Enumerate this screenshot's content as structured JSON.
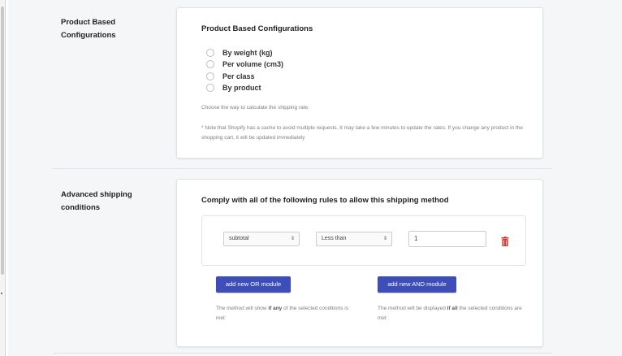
{
  "product_section": {
    "title": "Product Based Configurations",
    "card_title": "Product Based Configurations",
    "options": [
      "By weight (kg)",
      "Per volume (cm3)",
      "Per class",
      "By product"
    ],
    "help": "Choose the way to calculate the shipping rate.",
    "note": "* Note that Shopify has a cache to avoid multiple requests. It may take a few minutes to update the rates. If you change any product in the shopping cart, it will be updated immediately"
  },
  "advanced_section": {
    "title": "Advanced shipping conditions",
    "card_title": "Comply with all of the following rules to allow this shipping method",
    "rule": {
      "field": "subtotal",
      "operator": "Less than",
      "value": "1"
    },
    "or_button": "add new OR module",
    "and_button": "add new AND module",
    "or_note": {
      "before": "The method will show ",
      "bold": "if any",
      "after": " of the selected conditions is met"
    },
    "and_note": {
      "before": "The method will be displayed ",
      "bold": "if all",
      "after": " the selected conditions are met"
    }
  },
  "colors": {
    "primary_button": "#3d4eb8",
    "delete_icon": "#e53935"
  },
  "icons": [
    "select-arrows-icon",
    "trash-icon"
  ]
}
